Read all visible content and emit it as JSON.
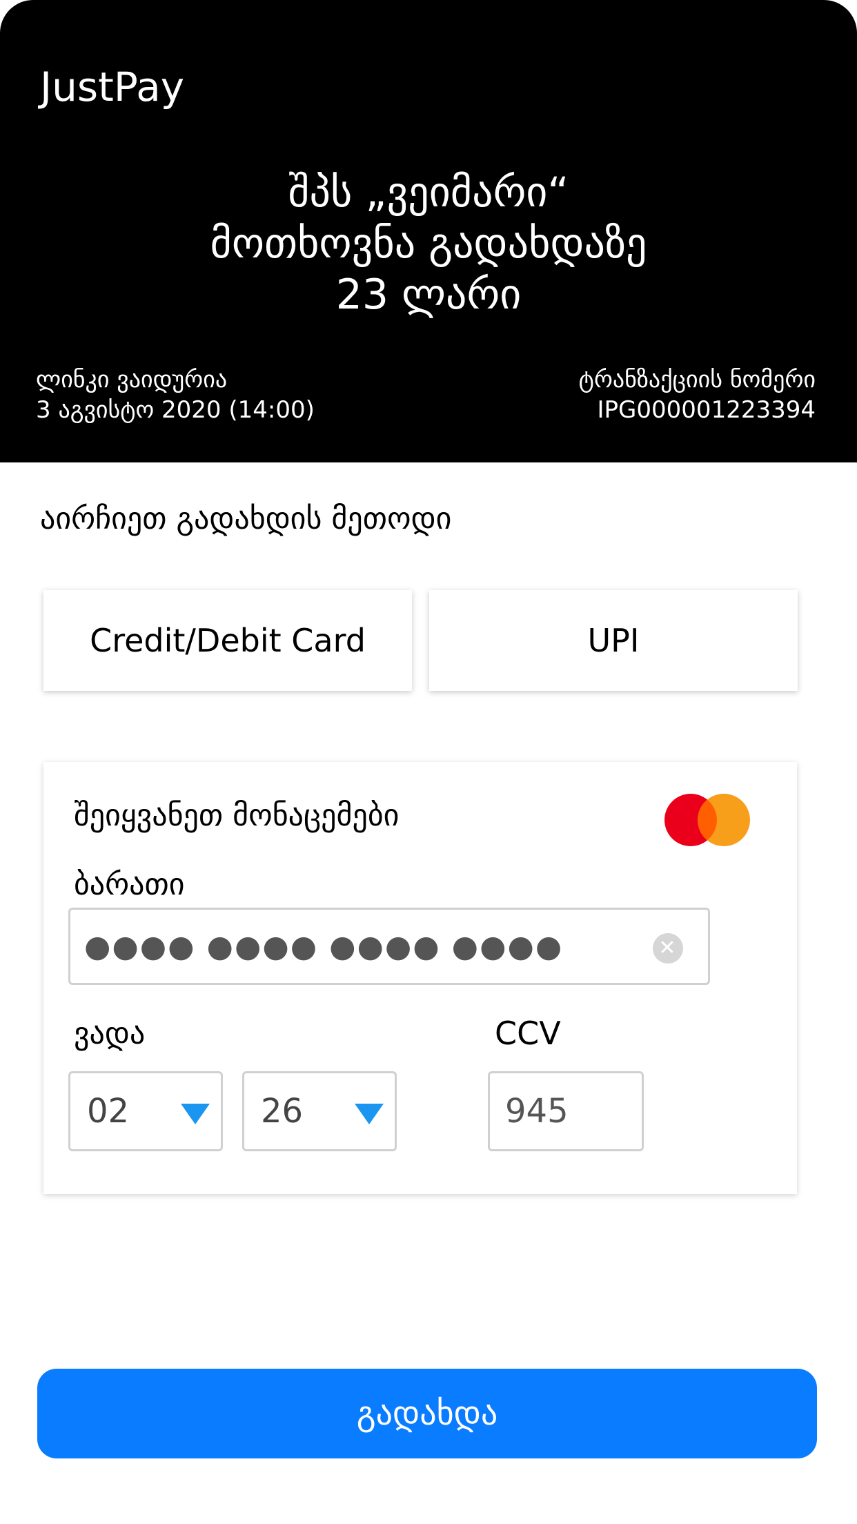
{
  "header": {
    "brand": "JustPay",
    "merchant_line1": "შპს „ვეიმარი“",
    "merchant_line2": "მოთხოვნა გადახდაზე",
    "amount": "23 ლარი",
    "expiry_label": "ლინკი ვაიდურია",
    "expiry_value": "3 აგვისტო 2020 (14:00)",
    "transaction_label": "ტრანზაქციის ნომერი",
    "transaction_value": "IPG000001223394"
  },
  "payment_method": {
    "title": "აირჩიეთ გადახდის მეთოდი",
    "options": [
      "Credit/Debit Card",
      "UPI"
    ]
  },
  "form": {
    "title": "შეიყვანეთ მონაცემები",
    "card_label": "ბარათი",
    "card_value": "●●●● ●●●● ●●●● ●●●●",
    "expiry_label": "ვადა",
    "month_value": "02",
    "year_value": "26",
    "ccv_label": "CCV",
    "ccv_value": "945",
    "card_brand_icon": "mastercard-icon"
  },
  "pay_button": "გადახდა",
  "colors": {
    "header_bg": "#000000",
    "accent": "#0a7cff",
    "caret": "#1a96f0",
    "mc_red": "#eb001b",
    "mc_orange": "#f79e1b"
  }
}
